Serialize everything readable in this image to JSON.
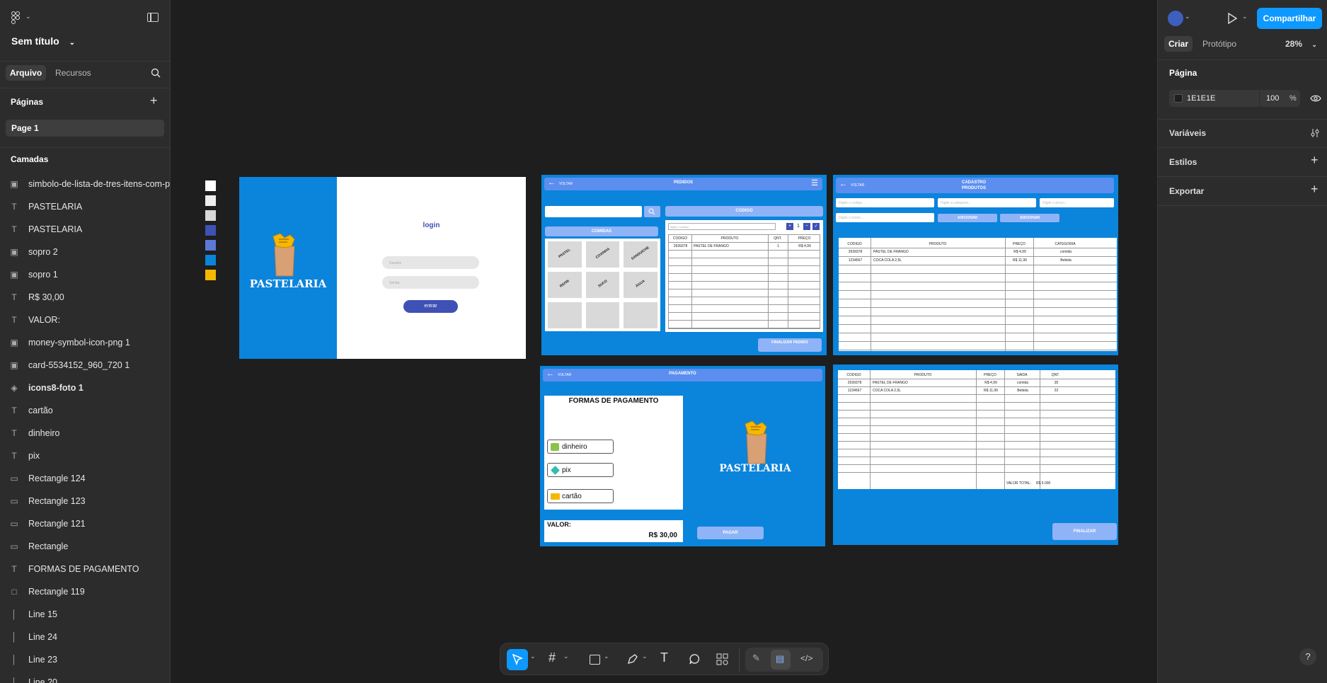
{
  "app": {
    "file_title": "Sem título"
  },
  "left": {
    "tabs": [
      "Arquivo",
      "Recursos"
    ],
    "pages_title": "Páginas",
    "page": "Page 1",
    "layers_title": "Camadas",
    "layers": [
      {
        "type": "img",
        "label": "simbolo-de-lista-de-tres-itens-com-p"
      },
      {
        "type": "text",
        "label": "PASTELARIA"
      },
      {
        "type": "text",
        "label": "PASTELARIA"
      },
      {
        "type": "img",
        "label": "sopro 2"
      },
      {
        "type": "img",
        "label": "sopro 1"
      },
      {
        "type": "text",
        "label": "R$ 30,00"
      },
      {
        "type": "text",
        "label": "VALOR:"
      },
      {
        "type": "img",
        "label": "money-symbol-icon-png 1"
      },
      {
        "type": "img",
        "label": "card-5534152_960_720 1"
      },
      {
        "type": "comp",
        "label": "icons8-foto 1"
      },
      {
        "type": "text",
        "label": "cartão"
      },
      {
        "type": "text",
        "label": "dinheiro"
      },
      {
        "type": "text",
        "label": "pix"
      },
      {
        "type": "rect",
        "label": "Rectangle 124"
      },
      {
        "type": "rect",
        "label": "Rectangle 123"
      },
      {
        "type": "rect",
        "label": "Rectangle 121"
      },
      {
        "type": "rect",
        "label": "Rectangle"
      },
      {
        "type": "text",
        "label": "FORMAS DE PAGAMENTO"
      },
      {
        "type": "frame",
        "label": "Rectangle 119"
      },
      {
        "type": "line",
        "label": "Line 15"
      },
      {
        "type": "line",
        "label": "Line 24"
      },
      {
        "type": "line",
        "label": "Line 23"
      },
      {
        "type": "line",
        "label": "Line 20"
      }
    ]
  },
  "right": {
    "share": "Compartilhar",
    "tab_create": "Criar",
    "tab_proto": "Protótipo",
    "zoom": "28%",
    "page_title": "Página",
    "color_hex": "1E1E1E",
    "opacity": "100",
    "pct": "%",
    "variables": "Variáveis",
    "styles": "Estilos",
    "export": "Exportar"
  },
  "swatches": [
    "#ffffff",
    "#eeeeee",
    "#d9d9d9",
    "#3f51b5",
    "#5c79d6",
    "#0b84db",
    "#f5b700"
  ],
  "login": {
    "brand": "PASTELARIA",
    "title": "login",
    "field1": "Usuário",
    "field2": "Senha",
    "button": "entrar"
  },
  "pedidos": {
    "back": "VOLTAR",
    "title": "PEDIDOS",
    "codigo": "CODIGO",
    "comidas": "COMIDAS",
    "code_ph": "digite o codigo",
    "qty": "1",
    "tiles": [
      "PASTEL",
      "COXINHA",
      "SANDUICHE",
      "REFRI",
      "SUCO",
      "ÁGUA",
      "",
      "",
      ""
    ],
    "cols": [
      "CODIGO",
      "PRODUTO",
      "QNT.",
      "PREÇO"
    ],
    "row": [
      "2939378",
      "PASTEL DE FRANGO",
      "1",
      "R$ 4,99"
    ],
    "finalizar": "FINALIZAR PEDIDO"
  },
  "cadastro": {
    "back": "VOLTAR",
    "title": "CADASTRO PRODUTOS",
    "ph1": "Digite o codigo...",
    "ph2": "Digite a categoria...",
    "ph3": "Digite o preço...",
    "ph4": "Digite o nome...",
    "add1": "ADICIONAR",
    "add2": "ADICIONAR",
    "cols": [
      "CODIGO",
      "PRODUTO",
      "PREÇO",
      "CATEGORIA"
    ],
    "rows": [
      [
        "2939378",
        "PASTEL DE FRANGO",
        "R$ 4,99",
        "comida"
      ],
      [
        "1234567",
        "COCA COLA 2,5L",
        "R$ 11,99",
        "Bebida"
      ]
    ]
  },
  "pagamento": {
    "back": "VOLTAR",
    "title": "PAGAMENTO",
    "formas": "FORMAS DE PAGAMENTO",
    "opt1": "dinheiro",
    "opt2": "pix",
    "opt3": "cartão",
    "valor_label": "VALOR:",
    "valor": "R$ 30,00",
    "pagar": "PAGAR",
    "brand": "PASTELARIA"
  },
  "relatorio": {
    "cols": [
      "CODIGO",
      "PRODUTO",
      "PREÇO",
      "SAIDA",
      "QNT."
    ],
    "rows": [
      [
        "2939378",
        "PASTEL DE FRANGO",
        "R$ 4,99",
        "comida",
        "35"
      ],
      [
        "1234567",
        "COCA COLA 2,5L",
        "R$ 11,99",
        "Bebida",
        "22"
      ]
    ],
    "total_label": "VALOR TOTAL:",
    "total": "R$ 5.000",
    "finalizar": "FINALIZAR"
  }
}
